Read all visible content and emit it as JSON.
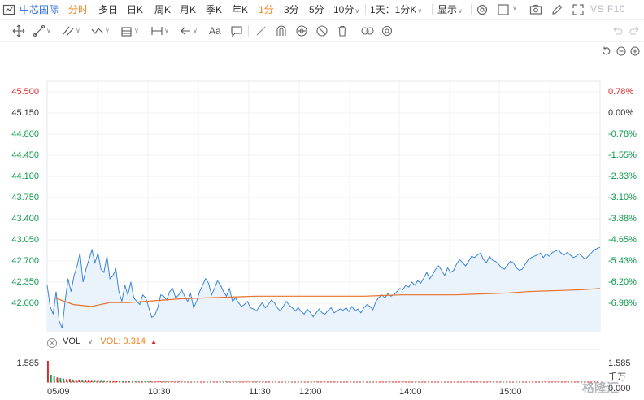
{
  "toolbar": {
    "stock_name": "中芯国际",
    "tabs": [
      "分时",
      "多日",
      "日K",
      "周K",
      "月K",
      "季K",
      "年K"
    ],
    "active_tab": "分时",
    "intervals": [
      "1分",
      "3分",
      "5分",
      "10分"
    ],
    "active_interval": "1分",
    "multi_period": "1天：1分K",
    "display": "显示",
    "vs_f10": "VS F10",
    "accent_color": "#f5831f",
    "stock_color": "#2f6fde"
  },
  "drawing_tools": {
    "text_tool": "Aa",
    "icons": [
      "move-icon",
      "line-icon",
      "channel-icon",
      "wave-icon",
      "fibonacci-icon",
      "measure-icon",
      "arrow-icon",
      "text-icon",
      "comment-icon",
      "ruler-icon",
      "magnet-icon",
      "eye-icon",
      "hide-icon",
      "trash-icon",
      "link-icon",
      "settings-icon",
      "undo-icon",
      "redo-icon"
    ]
  },
  "price_axis": [
    "45.500",
    "45.150",
    "44.800",
    "44.450",
    "44.100",
    "43.750",
    "43.400",
    "43.050",
    "42.700",
    "42.350",
    "42.000"
  ],
  "percent_axis": [
    "0.78%",
    "0.00%",
    "-0.78%",
    "-1.55%",
    "-2.33%",
    "-3.10%",
    "-3.88%",
    "-4.65%",
    "-5.43%",
    "-6.20%",
    "-6.98%"
  ],
  "volume": {
    "name": "VOL",
    "value_text": "VOL: 0.314",
    "arrow": "▲",
    "max_label_left": "1.585",
    "max_label_right": "1.585",
    "unit": "千万",
    "zero_right": "0.000"
  },
  "time_axis": [
    "05/09",
    "10:30",
    "11:30",
    "12:00",
    "14:00",
    "15:00"
  ],
  "watermark": "格隆汇",
  "chart_data": {
    "type": "line",
    "title": "",
    "xlabel": "",
    "ylabel": "",
    "ylim": [
      41.74,
      45.62
    ],
    "prev_close": 45.15,
    "price_series": [
      42.45,
      42.12,
      42.0,
      42.35,
      41.9,
      41.78,
      42.2,
      42.55,
      42.35,
      42.6,
      42.75,
      42.95,
      42.5,
      42.7,
      42.85,
      43.0,
      42.8,
      42.95,
      42.7,
      42.65,
      42.9,
      42.55,
      42.6,
      42.7,
      42.35,
      42.2,
      42.45,
      42.3,
      42.5,
      42.25,
      42.2,
      42.15,
      42.3,
      42.25,
      42.1,
      41.95,
      41.98,
      42.1,
      42.3,
      42.28,
      42.22,
      42.35,
      42.4,
      42.25,
      42.3,
      42.38,
      42.28,
      42.2,
      42.32,
      42.1,
      42.2,
      42.35,
      42.45,
      42.55,
      42.48,
      42.3,
      42.4,
      42.52,
      42.45,
      42.35,
      42.28,
      42.4,
      42.2,
      42.25,
      42.18,
      42.12,
      42.15,
      42.2,
      42.1,
      42.08,
      42.05,
      42.12,
      42.18,
      42.1,
      42.15,
      42.22,
      42.18,
      42.1,
      42.05,
      42.12,
      42.2,
      42.14,
      42.1,
      42.05,
      42.1,
      42.04,
      42.0,
      42.08,
      42.03,
      41.96,
      42.02,
      42.08,
      42.02,
      42.0,
      42.06,
      42.1,
      42.02,
      42.05,
      42.08,
      42.06,
      42.1,
      42.04,
      42.12,
      42.05,
      42.08,
      42.02,
      42.1,
      42.15,
      42.12,
      42.07,
      42.2,
      42.26,
      42.3,
      42.25,
      42.32,
      42.28,
      42.3,
      42.35,
      42.4,
      42.38,
      42.45,
      42.42,
      42.5,
      42.45,
      42.52,
      42.48,
      42.56,
      42.65,
      42.55,
      42.62,
      42.7,
      42.75,
      42.68,
      42.6,
      42.72,
      42.65,
      42.68,
      42.78,
      42.85,
      42.8,
      42.75,
      42.82,
      42.9,
      42.88,
      42.92,
      42.95,
      42.85,
      42.8,
      42.9,
      42.84,
      42.82,
      42.78,
      42.72,
      42.7,
      42.76,
      42.82,
      42.8,
      42.72,
      42.68,
      42.7,
      42.78,
      42.85,
      42.88,
      42.9,
      42.92,
      42.95,
      42.88,
      42.94,
      42.9,
      42.96,
      42.98,
      43.0,
      42.95,
      42.92,
      42.96,
      42.92,
      42.88,
      42.9,
      42.94,
      42.9,
      42.85,
      42.9,
      42.95,
      43.0,
      43.02,
      43.04
    ],
    "avg_series": [
      42.25,
      42.15,
      42.12,
      42.18,
      42.18,
      42.2,
      42.22,
      42.24,
      42.25,
      42.26,
      42.27,
      42.28,
      42.28,
      42.28,
      42.28,
      42.28,
      42.28,
      42.28,
      42.29,
      42.3,
      42.3,
      42.3,
      42.3,
      42.31,
      42.32,
      42.33,
      42.35,
      42.36,
      42.37,
      42.38,
      42.4
    ],
    "volume_values": [
      1.585,
      0.55,
      0.42,
      0.34,
      0.3,
      0.26,
      0.22,
      0.24,
      0.19,
      0.16,
      0.14,
      0.12,
      0.13,
      0.11,
      0.1,
      0.09,
      0.11,
      0.09,
      0.08,
      0.07,
      0.08,
      0.07,
      0.06,
      0.07,
      0.06,
      0.05,
      0.06,
      0.05,
      0.05,
      0.04,
      0.05,
      0.04,
      0.04,
      0.05,
      0.04,
      0.04,
      0.05,
      0.04,
      0.04,
      0.03,
      0.04,
      0.03,
      0.04,
      0.03,
      0.03,
      0.04,
      0.03,
      0.03,
      0.04,
      0.03,
      0.03,
      0.03,
      0.04,
      0.03,
      0.03,
      0.03,
      0.03,
      0.04,
      0.03,
      0.03,
      0.03,
      0.03,
      0.02,
      0.03,
      0.03,
      0.02,
      0.03,
      0.03,
      0.02,
      0.03,
      0.03,
      0.02,
      0.03,
      0.02,
      0.02,
      0.03,
      0.02,
      0.02,
      0.03,
      0.02,
      0.02,
      0.03,
      0.02,
      0.02,
      0.02,
      0.02,
      0.03,
      0.02,
      0.02,
      0.02,
      0.02,
      0.02,
      0.03,
      0.02,
      0.02,
      0.02,
      0.02,
      0.02,
      0.02,
      0.03,
      0.02,
      0.02,
      0.02,
      0.03,
      0.02,
      0.02,
      0.02,
      0.02,
      0.02,
      0.03,
      0.02,
      0.02,
      0.02,
      0.02,
      0.03,
      0.02,
      0.02,
      0.02,
      0.02,
      0.02,
      0.03,
      0.02,
      0.02,
      0.02,
      0.02,
      0.03,
      0.02,
      0.02,
      0.02,
      0.02,
      0.03,
      0.02,
      0.02,
      0.02,
      0.03,
      0.02,
      0.02,
      0.03,
      0.02,
      0.02,
      0.02,
      0.03,
      0.02,
      0.02,
      0.02,
      0.03,
      0.02,
      0.02,
      0.02,
      0.02,
      0.03,
      0.02,
      0.02,
      0.02,
      0.02,
      0.03,
      0.02,
      0.02,
      0.02,
      0.03,
      0.02,
      0.02,
      0.03,
      0.03,
      0.02,
      0.02,
      0.03,
      0.02,
      0.02,
      0.03,
      0.02,
      0.02,
      0.03,
      0.02,
      0.03,
      0.04,
      0.05
    ],
    "price_color": "#3a86d6",
    "avg_color": "#e8732b",
    "up_color": "#e02424",
    "down_color": "#0f9a4a",
    "grid": true
  }
}
